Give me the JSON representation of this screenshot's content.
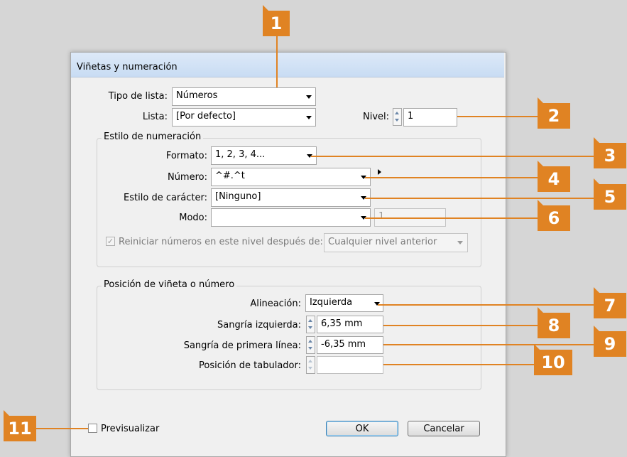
{
  "dialog": {
    "title": "Viñetas y numeración",
    "list_type_label": "Tipo de lista:",
    "list_type_value": "Números",
    "list_label": "Lista:",
    "list_value": "[Por defecto]",
    "level_label": "Nivel:",
    "level_value": "1",
    "numbering_style": {
      "group_title": "Estilo de numeración",
      "format_label": "Formato:",
      "format_value": "1, 2, 3, 4...",
      "number_label": "Número:",
      "number_value": "^#.^t",
      "char_style_label": "Estilo de carácter:",
      "char_style_value": "[Ninguno]",
      "mode_label": "Modo:",
      "mode_value": "",
      "mode_start_value": "1",
      "restart_label": "Reiniciar números en este nivel después de:",
      "restart_checked": true,
      "restart_value": "Cualquier nivel anterior"
    },
    "position": {
      "group_title": "Posición de viñeta o número",
      "alignment_label": "Alineación:",
      "alignment_value": "Izquierda",
      "left_indent_label": "Sangría izquierda:",
      "left_indent_value": "6,35 mm",
      "first_line_indent_label": "Sangría de primera línea:",
      "first_line_indent_value": "-6,35 mm",
      "tab_position_label": "Posición de tabulador:",
      "tab_position_value": ""
    },
    "preview_label": "Previsualizar",
    "preview_checked": false,
    "ok_label": "OK",
    "cancel_label": "Cancelar"
  },
  "callouts": [
    "1",
    "2",
    "3",
    "4",
    "5",
    "6",
    "7",
    "8",
    "9",
    "10",
    "11"
  ],
  "colors": {
    "callout": "#e08323",
    "background": "#d6d6d6",
    "dialog": "#f0f0f0"
  }
}
